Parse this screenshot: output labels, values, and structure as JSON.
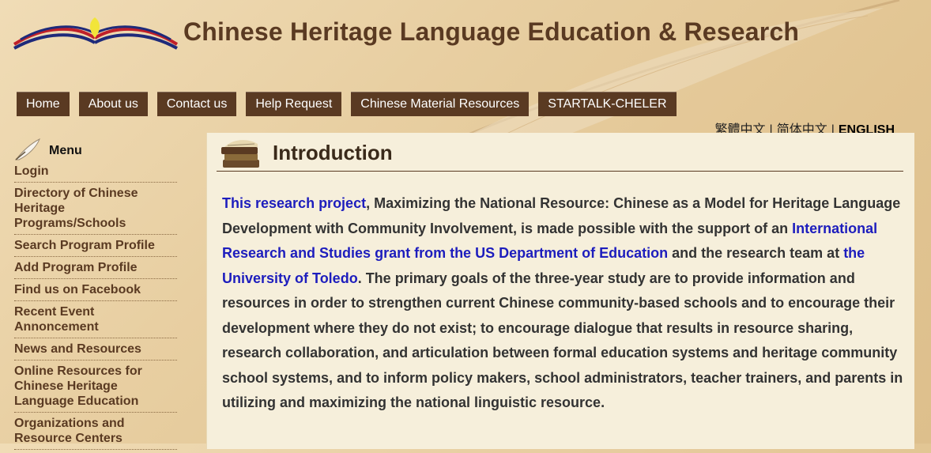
{
  "header": {
    "title": "Chinese Heritage Language Education & Research"
  },
  "nav": {
    "items": [
      "Home",
      "About us",
      "Contact us",
      "Help Request",
      "Chinese Material Resources",
      "STARTALK-CHELER"
    ]
  },
  "lang": {
    "traditional": "繁體中文",
    "simplified": "简体中文",
    "english": "ENGLISH",
    "separator": "|"
  },
  "sidebar": {
    "title": "Menu",
    "items": [
      "Login",
      "Directory of Chinese Heritage Programs/Schools",
      "Search Program Profile",
      "Add Program Profile",
      "Find us on Facebook",
      "Recent Event Annoncement",
      "News and Resources",
      "Online Resources for Chinese Heritage Language Education",
      "Organizations and Resource Centers"
    ]
  },
  "content": {
    "title": "Introduction",
    "p": {
      "link1": "This research project",
      "t1": ", Maximizing the National Resource: Chinese as a Model for Heritage Language Development with Community Involvement, is made possible with the support of an ",
      "link2": "International Research and Studies grant from the US Department of Education",
      "t2": " and the research team at ",
      "link3": "the University of Toledo",
      "t3": ". The primary goals of the three-year study are to provide information and resources in order to strengthen current Chinese community-based schools and to encourage their development where they do not exist; to encourage dialogue that results in resource sharing, research collaboration, and articulation between formal education systems and heritage community school systems, and to inform policy makers, school administrators, teacher trainers, and parents in utilizing and maximizing the national linguistic resource."
    }
  },
  "colors": {
    "brand_brown": "#5a3a22",
    "link_blue": "#1d1dbd",
    "panel_bg": "#f6efdb"
  },
  "icons": [
    "open-book-logo-icon",
    "quill-icon",
    "books-stack-icon"
  ]
}
